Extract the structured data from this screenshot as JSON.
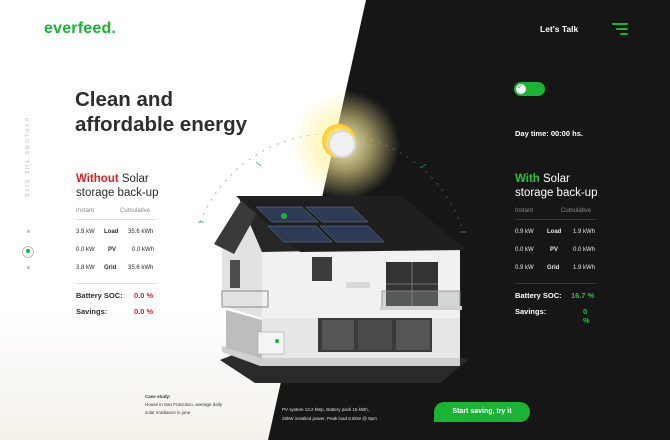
{
  "brand": {
    "logo": "everfeed.",
    "accent": "#1bb334",
    "danger": "#e21f1f"
  },
  "header": {
    "lets_talk": "Let's Talk",
    "menu_icon": "hamburger-menu-icon"
  },
  "hero": {
    "line1": "Clean and",
    "line2": "affordable energy"
  },
  "sidebar": {
    "vertical_text": "EXPLORE THE SITE"
  },
  "left_panel": {
    "title_highlight": "Without",
    "title_rest1": " Solar",
    "title_line2": "storage back-up",
    "col_instant": "Instant",
    "col_cumulative": "Cumulative",
    "rows": [
      {
        "instant": "3.8 kW",
        "label": "Load",
        "cumulative": "35.6 kWh"
      },
      {
        "instant": "0.0 kW",
        "label": "PV",
        "cumulative": "0.0 kWh"
      },
      {
        "instant": "3.8 kW",
        "label": "Grid",
        "cumulative": "35.6 kWh"
      }
    ],
    "battery_label": "Battery SOC:",
    "battery_value": "0.0 %",
    "savings_label": "Savings:",
    "savings_value": "0.0 %"
  },
  "right_panel": {
    "toggle_on": true,
    "daytime": "Day time: 00:00 hs.",
    "title_highlight": "With",
    "title_rest1": " Solar",
    "title_line2": "storage back-up",
    "col_instant": "Instant",
    "col_cumulative": "Cumulative",
    "rows": [
      {
        "instant": "0.9 kW",
        "label": "Load",
        "cumulative": "1.9 kWh"
      },
      {
        "instant": "0.0 kW",
        "label": "PV",
        "cumulative": "0.0 kWh"
      },
      {
        "instant": "0.9 kW",
        "label": "Grid",
        "cumulative": "1.9 kWh"
      }
    ],
    "battery_label": "Battery SOC:",
    "battery_value": "16.7 %",
    "savings_label": "Savings:",
    "savings_value": "0 %"
  },
  "case_study": {
    "heading": "Case study:",
    "line1": "House in San Francisco, average daily",
    "line2": "solar irradiance in june"
  },
  "specs": {
    "line1": "PV system 13.2 kWp, Battery pack 15 kWh,",
    "line2": "26kW installed power, Peak load 8.5kW @ 9pm"
  },
  "cta": {
    "label": "Start saving, try it"
  }
}
